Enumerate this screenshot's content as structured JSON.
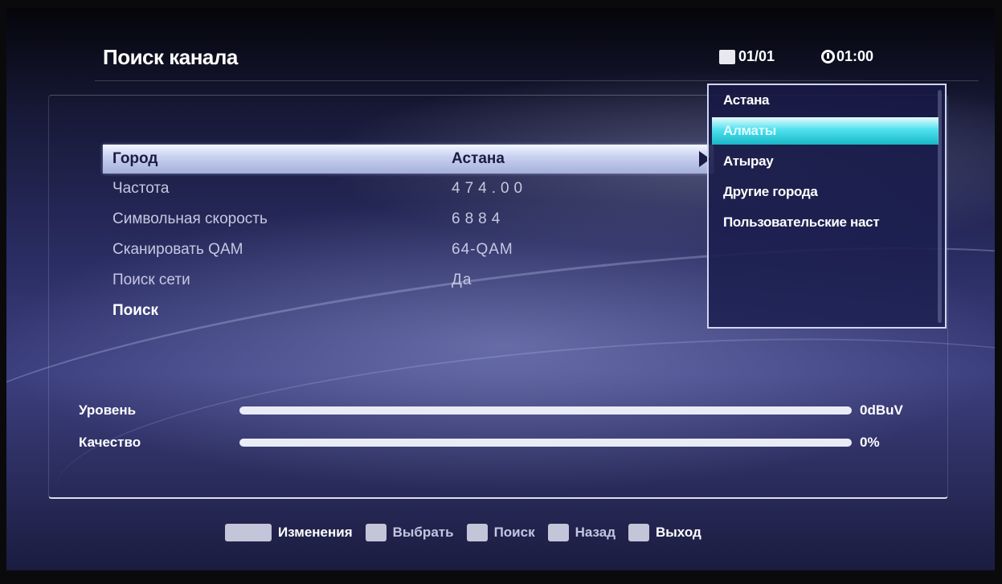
{
  "header": {
    "title": "Поиск канала",
    "page_indicator": "01/01",
    "clock": "01:00"
  },
  "settings": [
    {
      "label": "Город",
      "value": "Астана"
    },
    {
      "label": "Частота",
      "value": "474.00"
    },
    {
      "label": "Символьная скорость",
      "value": "6884"
    },
    {
      "label": "Сканировать QAM",
      "value": "64-QAM"
    },
    {
      "label": "Поиск сети",
      "value": "Да"
    },
    {
      "label": "Поиск",
      "value": ""
    }
  ],
  "city_dropdown": {
    "options": [
      "Астана",
      "Алматы",
      "Атырау",
      "Другие города",
      "Пользовательские наст"
    ],
    "highlighted": "Алматы"
  },
  "meters": {
    "level": {
      "label": "Уровень",
      "value": "0dBuV",
      "fraction": 0
    },
    "quality": {
      "label": "Качество",
      "value": "0%",
      "fraction": 0
    }
  },
  "footer": {
    "edit": "Изменения",
    "select": "Выбрать",
    "search": "Поиск",
    "back": "Назад",
    "exit": "Выход"
  },
  "colors": {
    "selected_row": "#c9d2f0",
    "dropdown_highlight": "#4fe1ee",
    "meter_track": "#e9ebf7"
  },
  "icons": {
    "page": "page-icon",
    "clock": "clock-icon",
    "arrow": "chevron-right-icon"
  }
}
